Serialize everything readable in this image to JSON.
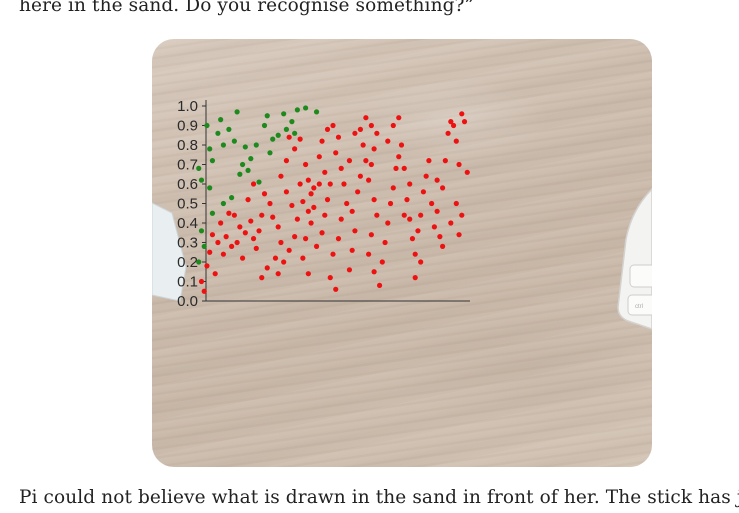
{
  "article": {
    "intro_text": "here in the sand. Do you recognise something?”",
    "story_text": "Pi could not believe what is drawn in the sand in front of her. The stick has just"
  },
  "photo": {
    "keyboard_key_label": "ctrl"
  },
  "colors": {
    "green_points": "#1e8a1e",
    "red_points": "#ee1111",
    "axis": "#333333"
  },
  "chart_data": {
    "type": "scatter",
    "y_ticks": [
      "0.0",
      "0.1",
      "0.2",
      "0.3",
      "0.4",
      "0.5",
      "0.6",
      "0.7",
      "0.8",
      "0.9",
      "1.0"
    ],
    "ylim": [
      0,
      1
    ],
    "xlim": [
      0,
      1
    ],
    "grid": false,
    "series": [
      {
        "color": "green",
        "points": [
          [
            0.01,
            0.68
          ],
          [
            0.05,
            0.78
          ],
          [
            0.1,
            0.8
          ],
          [
            0.02,
            0.62
          ],
          [
            0.05,
            0.58
          ],
          [
            0.08,
            0.86
          ],
          [
            0.04,
            0.9
          ],
          [
            0.09,
            0.93
          ],
          [
            0.12,
            0.88
          ],
          [
            0.15,
            0.97
          ],
          [
            0.14,
            0.82
          ],
          [
            0.18,
            0.79
          ],
          [
            0.22,
            0.8
          ],
          [
            0.25,
            0.9
          ],
          [
            0.2,
            0.73
          ],
          [
            0.19,
            0.67
          ],
          [
            0.23,
            0.61
          ],
          [
            0.17,
            0.7
          ],
          [
            0.27,
            0.76
          ],
          [
            0.3,
            0.85
          ],
          [
            0.32,
            0.96
          ],
          [
            0.33,
            0.88
          ],
          [
            0.35,
            0.92
          ],
          [
            0.37,
            0.98
          ],
          [
            0.4,
            0.99
          ],
          [
            0.44,
            0.97
          ],
          [
            0.26,
            0.95
          ],
          [
            0.36,
            0.86
          ],
          [
            0.02,
            0.36
          ],
          [
            0.06,
            0.45
          ],
          [
            0.1,
            0.5
          ],
          [
            0.13,
            0.53
          ],
          [
            0.01,
            0.2
          ],
          [
            0.03,
            0.28
          ],
          [
            0.28,
            0.83
          ],
          [
            0.16,
            0.65
          ],
          [
            0.06,
            0.72
          ]
        ]
      },
      {
        "color": "red",
        "points": [
          [
            0.06,
            0.34
          ],
          [
            0.04,
            0.18
          ],
          [
            0.02,
            0.1
          ],
          [
            0.05,
            0.25
          ],
          [
            0.08,
            0.3
          ],
          [
            0.09,
            0.4
          ],
          [
            0.11,
            0.33
          ],
          [
            0.13,
            0.28
          ],
          [
            0.15,
            0.3
          ],
          [
            0.17,
            0.22
          ],
          [
            0.16,
            0.38
          ],
          [
            0.18,
            0.35
          ],
          [
            0.2,
            0.41
          ],
          [
            0.21,
            0.32
          ],
          [
            0.22,
            0.27
          ],
          [
            0.23,
            0.36
          ],
          [
            0.24,
            0.44
          ],
          [
            0.19,
            0.52
          ],
          [
            0.21,
            0.6
          ],
          [
            0.25,
            0.55
          ],
          [
            0.27,
            0.5
          ],
          [
            0.28,
            0.43
          ],
          [
            0.3,
            0.38
          ],
          [
            0.31,
            0.3
          ],
          [
            0.29,
            0.22
          ],
          [
            0.26,
            0.17
          ],
          [
            0.24,
            0.12
          ],
          [
            0.3,
            0.14
          ],
          [
            0.32,
            0.2
          ],
          [
            0.34,
            0.26
          ],
          [
            0.36,
            0.33
          ],
          [
            0.37,
            0.42
          ],
          [
            0.35,
            0.49
          ],
          [
            0.33,
            0.56
          ],
          [
            0.31,
            0.64
          ],
          [
            0.33,
            0.72
          ],
          [
            0.36,
            0.78
          ],
          [
            0.38,
            0.83
          ],
          [
            0.34,
            0.84
          ],
          [
            0.4,
            0.7
          ],
          [
            0.41,
            0.62
          ],
          [
            0.42,
            0.55
          ],
          [
            0.43,
            0.48
          ],
          [
            0.42,
            0.4
          ],
          [
            0.4,
            0.32
          ],
          [
            0.39,
            0.22
          ],
          [
            0.41,
            0.14
          ],
          [
            0.44,
            0.28
          ],
          [
            0.46,
            0.35
          ],
          [
            0.47,
            0.44
          ],
          [
            0.48,
            0.52
          ],
          [
            0.49,
            0.6
          ],
          [
            0.47,
            0.66
          ],
          [
            0.45,
            0.74
          ],
          [
            0.46,
            0.82
          ],
          [
            0.48,
            0.88
          ],
          [
            0.5,
            0.9
          ],
          [
            0.52,
            0.84
          ],
          [
            0.51,
            0.76
          ],
          [
            0.53,
            0.68
          ],
          [
            0.54,
            0.6
          ],
          [
            0.55,
            0.5
          ],
          [
            0.53,
            0.42
          ],
          [
            0.52,
            0.32
          ],
          [
            0.5,
            0.24
          ],
          [
            0.49,
            0.12
          ],
          [
            0.51,
            0.06
          ],
          [
            0.56,
            0.16
          ],
          [
            0.57,
            0.26
          ],
          [
            0.58,
            0.36
          ],
          [
            0.57,
            0.46
          ],
          [
            0.59,
            0.56
          ],
          [
            0.6,
            0.64
          ],
          [
            0.62,
            0.72
          ],
          [
            0.61,
            0.8
          ],
          [
            0.6,
            0.88
          ],
          [
            0.62,
            0.94
          ],
          [
            0.64,
            0.9
          ],
          [
            0.66,
            0.86
          ],
          [
            0.65,
            0.78
          ],
          [
            0.64,
            0.7
          ],
          [
            0.63,
            0.62
          ],
          [
            0.65,
            0.52
          ],
          [
            0.66,
            0.44
          ],
          [
            0.64,
            0.34
          ],
          [
            0.63,
            0.24
          ],
          [
            0.65,
            0.15
          ],
          [
            0.67,
            0.08
          ],
          [
            0.68,
            0.2
          ],
          [
            0.69,
            0.3
          ],
          [
            0.7,
            0.4
          ],
          [
            0.71,
            0.5
          ],
          [
            0.72,
            0.58
          ],
          [
            0.73,
            0.68
          ],
          [
            0.74,
            0.74
          ],
          [
            0.75,
            0.8
          ],
          [
            0.76,
            0.68
          ],
          [
            0.77,
            0.52
          ],
          [
            0.78,
            0.42
          ],
          [
            0.79,
            0.32
          ],
          [
            0.8,
            0.24
          ],
          [
            0.81,
            0.36
          ],
          [
            0.82,
            0.44
          ],
          [
            0.83,
            0.56
          ],
          [
            0.84,
            0.64
          ],
          [
            0.85,
            0.72
          ],
          [
            0.86,
            0.5
          ],
          [
            0.87,
            0.38
          ],
          [
            0.88,
            0.46
          ],
          [
            0.89,
            0.33
          ],
          [
            0.9,
            0.58
          ],
          [
            0.91,
            0.72
          ],
          [
            0.92,
            0.86
          ],
          [
            0.93,
            0.92
          ],
          [
            0.94,
            0.9
          ],
          [
            0.95,
            0.82
          ],
          [
            0.96,
            0.7
          ],
          [
            0.97,
            0.96
          ],
          [
            0.98,
            0.92
          ],
          [
            0.99,
            0.66
          ],
          [
            0.43,
            0.58
          ],
          [
            0.45,
            0.6
          ],
          [
            0.41,
            0.46
          ],
          [
            0.39,
            0.51
          ],
          [
            0.38,
            0.6
          ],
          [
            0.58,
            0.86
          ],
          [
            0.56,
            0.72
          ],
          [
            0.7,
            0.82
          ],
          [
            0.72,
            0.9
          ],
          [
            0.74,
            0.94
          ],
          [
            0.12,
            0.45
          ],
          [
            0.14,
            0.44
          ],
          [
            0.1,
            0.24
          ],
          [
            0.07,
            0.14
          ],
          [
            0.03,
            0.05
          ],
          [
            0.82,
            0.2
          ],
          [
            0.8,
            0.12
          ],
          [
            0.78,
            0.6
          ],
          [
            0.76,
            0.44
          ],
          [
            0.88,
            0.62
          ],
          [
            0.9,
            0.28
          ],
          [
            0.93,
            0.4
          ],
          [
            0.95,
            0.5
          ],
          [
            0.97,
            0.44
          ],
          [
            0.96,
            0.34
          ]
        ]
      }
    ]
  }
}
